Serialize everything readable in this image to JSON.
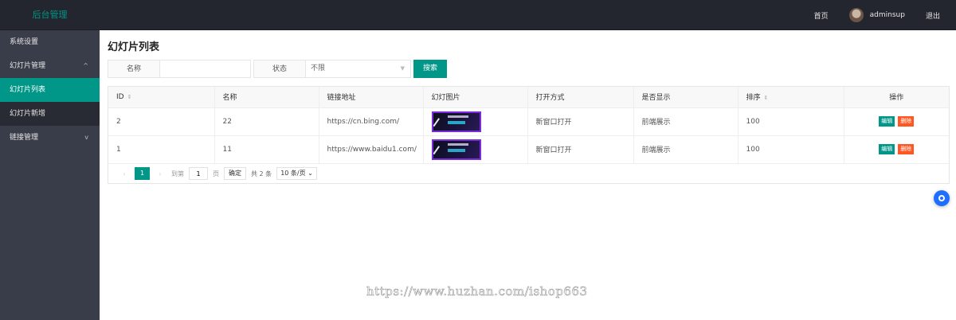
{
  "header": {
    "logo": "后台管理",
    "home": "首页",
    "username": "adminsup",
    "logout": "退出"
  },
  "sidebar": {
    "items": [
      {
        "label": "系统设置"
      },
      {
        "label": "幻灯片管理",
        "chevron": "^"
      },
      {
        "label": "幻灯片列表"
      },
      {
        "label": "幻灯片新增"
      },
      {
        "label": "链接管理",
        "chevron": "v"
      }
    ]
  },
  "page": {
    "title": "幻灯片列表"
  },
  "search": {
    "name_label": "名称",
    "name_value": "",
    "status_label": "状态",
    "status_value": "不限",
    "search_button": "搜索"
  },
  "table": {
    "headers": {
      "id": "ID",
      "name": "名称",
      "link": "链接地址",
      "image": "幻灯图片",
      "open": "打开方式",
      "display": "是否显示",
      "sort": "排序",
      "ops": "操作"
    },
    "rows": [
      {
        "id": "2",
        "name": "22",
        "link": "https://cn.bing.com/",
        "open": "新窗口打开",
        "display": "前端展示",
        "sort": "100",
        "edit": "编辑",
        "del": "删除"
      },
      {
        "id": "1",
        "name": "11",
        "link": "https://www.baidu1.com/",
        "open": "新窗口打开",
        "display": "前端展示",
        "sort": "100",
        "edit": "编辑",
        "del": "删除"
      }
    ]
  },
  "pager": {
    "current": "1",
    "goto_label": "到第",
    "goto_value": "1",
    "page_unit": "页",
    "confirm": "确定",
    "total": "共 2 条",
    "page_size": "10 条/页"
  },
  "watermark": "https://www.huzhan.com/ishop663",
  "colors": {
    "accent": "#009688",
    "danger": "#ff5722",
    "header_bg": "#23262e",
    "sidebar_bg": "#393d49"
  }
}
